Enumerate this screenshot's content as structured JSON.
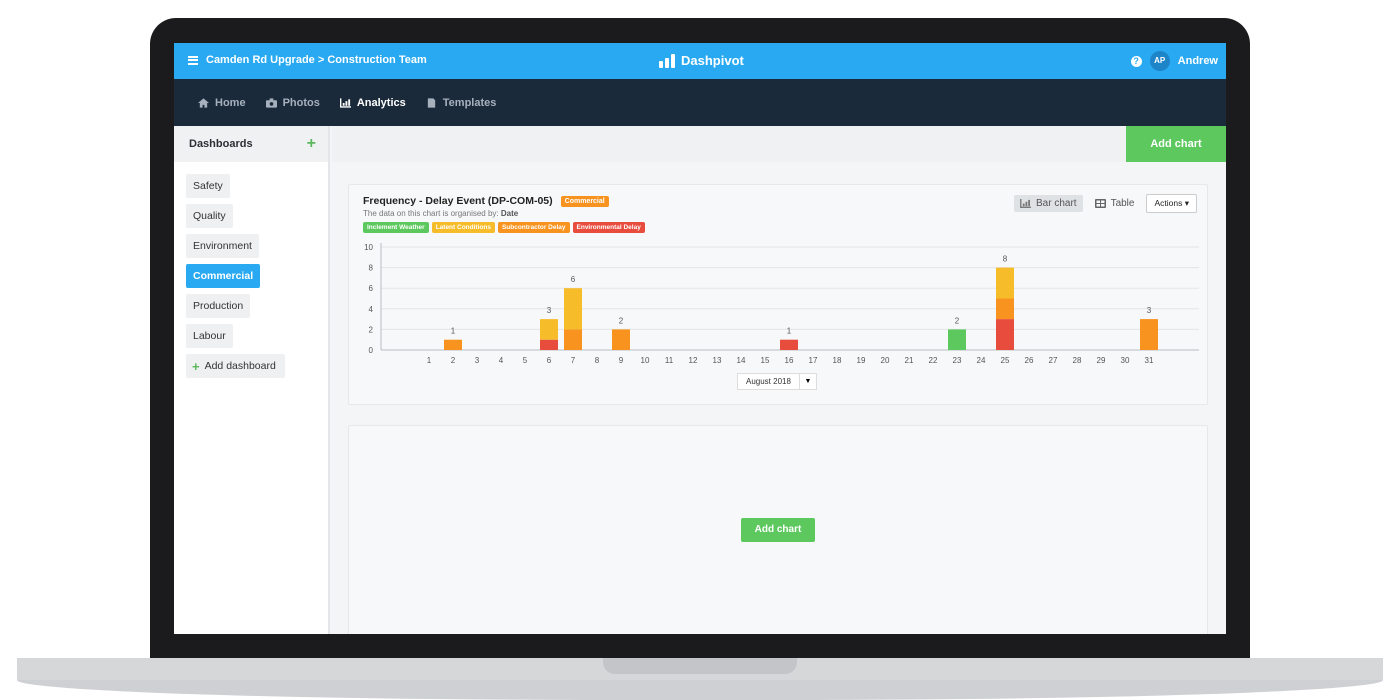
{
  "header": {
    "breadcrumb": "Camden Rd Upgrade > Construction Team",
    "brand": "Dashpivot",
    "help_icon": "?",
    "avatar_initials": "AP",
    "user_name": "Andrew",
    "color": "#28a9f1"
  },
  "nav": {
    "items": [
      {
        "label": "Home",
        "icon": "home-icon"
      },
      {
        "label": "Photos",
        "icon": "camera-icon"
      },
      {
        "label": "Analytics",
        "icon": "chart-icon",
        "active": true
      },
      {
        "label": "Templates",
        "icon": "document-icon"
      }
    ]
  },
  "sidebar": {
    "title": "Dashboards",
    "items": [
      "Safety",
      "Quality",
      "Environment",
      "Commercial",
      "Production",
      "Labour"
    ],
    "active": "Commercial",
    "add_label": "Add dashboard"
  },
  "main": {
    "add_chart_label": "Add chart"
  },
  "chart_card": {
    "title": "Frequency - Delay Event (DP-COM-05)",
    "tag": "Commercial",
    "subtitle_prefix": "The data on this chart is organised by:",
    "subtitle_value": "Date",
    "view_bar": "Bar chart",
    "view_table": "Table",
    "actions": "Actions",
    "month": "August 2018"
  },
  "empty_card": {
    "add_chart_label": "Add chart"
  },
  "chart_data": {
    "type": "bar",
    "stacked": true,
    "title": "Frequency - Delay Event (DP-COM-05)",
    "categories": [
      "1",
      "2",
      "3",
      "4",
      "5",
      "6",
      "7",
      "8",
      "9",
      "10",
      "11",
      "12",
      "13",
      "14",
      "15",
      "16",
      "17",
      "18",
      "19",
      "20",
      "21",
      "22",
      "23",
      "24",
      "25",
      "26",
      "27",
      "28",
      "29",
      "30",
      "31"
    ],
    "ylim": [
      0,
      10
    ],
    "yticks": [
      0,
      2,
      4,
      6,
      8,
      10
    ],
    "grid": true,
    "series": [
      {
        "name": "Environmental Delay",
        "color": "#e84c3d",
        "values": [
          0,
          0,
          0,
          0,
          0,
          1,
          0,
          0,
          0,
          0,
          0,
          0,
          0,
          0,
          0,
          1,
          0,
          0,
          0,
          0,
          0,
          0,
          0,
          0,
          3,
          0,
          0,
          0,
          0,
          0,
          0
        ]
      },
      {
        "name": "Subcontractor Delay",
        "color": "#f7931e",
        "values": [
          0,
          1,
          0,
          0,
          0,
          0,
          2,
          0,
          2,
          0,
          0,
          0,
          0,
          0,
          0,
          0,
          0,
          0,
          0,
          0,
          0,
          0,
          0,
          0,
          2,
          0,
          0,
          0,
          0,
          0,
          3
        ]
      },
      {
        "name": "Latent Conditions",
        "color": "#f7bc2a",
        "values": [
          0,
          0,
          0,
          0,
          0,
          2,
          4,
          0,
          0,
          0,
          0,
          0,
          0,
          0,
          0,
          0,
          0,
          0,
          0,
          0,
          0,
          0,
          0,
          0,
          3,
          0,
          0,
          0,
          0,
          0,
          0
        ]
      },
      {
        "name": "Inclement Weather",
        "color": "#5cc85e",
        "values": [
          0,
          0,
          0,
          0,
          0,
          0,
          0,
          0,
          0,
          0,
          0,
          0,
          0,
          0,
          0,
          0,
          0,
          0,
          0,
          0,
          0,
          0,
          2,
          0,
          0,
          0,
          0,
          0,
          0,
          0,
          0
        ]
      }
    ],
    "legend_order": [
      "Inclement Weather",
      "Latent Conditions",
      "Subcontractor Delay",
      "Environmental Delay"
    ],
    "totals": [
      0,
      1,
      0,
      0,
      0,
      3,
      6,
      0,
      2,
      0,
      0,
      0,
      0,
      0,
      0,
      1,
      0,
      0,
      0,
      0,
      0,
      0,
      2,
      0,
      8,
      0,
      0,
      0,
      0,
      0,
      3
    ]
  }
}
